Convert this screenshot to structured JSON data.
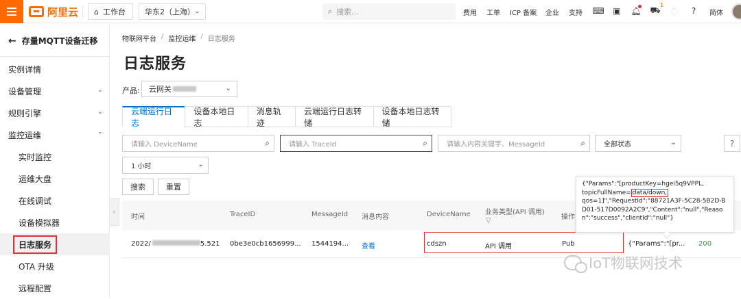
{
  "topbar": {
    "logo_text": "阿里云",
    "workbench": "工作台",
    "region": "华东2（上海）",
    "search_placeholder": "搜索...",
    "links": [
      "费用",
      "工单",
      "ICP 备案",
      "企业",
      "支持"
    ],
    "cart_badge": "1",
    "lang": "简体"
  },
  "sidebar": {
    "back_title": "存量MQTT设备迁移",
    "items": [
      {
        "label": "实例详情"
      },
      {
        "label": "设备管理"
      },
      {
        "label": "规则引擎"
      },
      {
        "label": "监控运维"
      },
      {
        "label": "实时监控"
      },
      {
        "label": "运维大盘"
      },
      {
        "label": "在线调试"
      },
      {
        "label": "设备模拟器"
      },
      {
        "label": "日志服务"
      },
      {
        "label": "OTA 升级"
      },
      {
        "label": "远程配置"
      }
    ]
  },
  "breadcrumb": [
    "物联网平台",
    "监控运维",
    "日志服务"
  ],
  "page_title": "日志服务",
  "product": {
    "label": "产品:",
    "value": "云网关"
  },
  "tabs": [
    "云端运行日志",
    "设备本地日志",
    "消息轨迹",
    "云端运行日志转储",
    "设备本地日志转储"
  ],
  "filters": {
    "device_placeholder": "请输入 DeviceName",
    "trace_placeholder": "请输入 TraceId",
    "msg_placeholder": "请输入内容关键字、MessageId",
    "status": "全部状态",
    "time": "1 小时",
    "search_btn": "搜索",
    "reset_btn": "重置"
  },
  "table": {
    "headers": [
      "时间",
      "TraceID",
      "MessageId",
      "消息内容",
      "DeviceName",
      "业务类型(API 调用)",
      "操作"
    ],
    "row": {
      "time_prefix": "2022/",
      "time_suffix": "5.521",
      "trace": "0be3e0cb1656999...",
      "message_id": "1544194...",
      "content": "查看",
      "device": "cdszn",
      "biz_type": "API 调用",
      "op": "Pub",
      "params": "{\"Params\":\"[pr...",
      "code": "200"
    }
  },
  "tooltip": {
    "line1": "{\"Params\":\"[productKey=hgei5q9VPPL,",
    "line2_pre": "topicFullName=",
    "line2_hl": "data/down,",
    "line3": "qos=1]\",\"RequestId\":\"88721A3F-5C28-5B2D-BD01-517D0092A2C9\",\"Content\":\"null\",\"Reason\":\"success\",\"clientId\":\"null\"}"
  },
  "watermark": "IoT物联网技术"
}
